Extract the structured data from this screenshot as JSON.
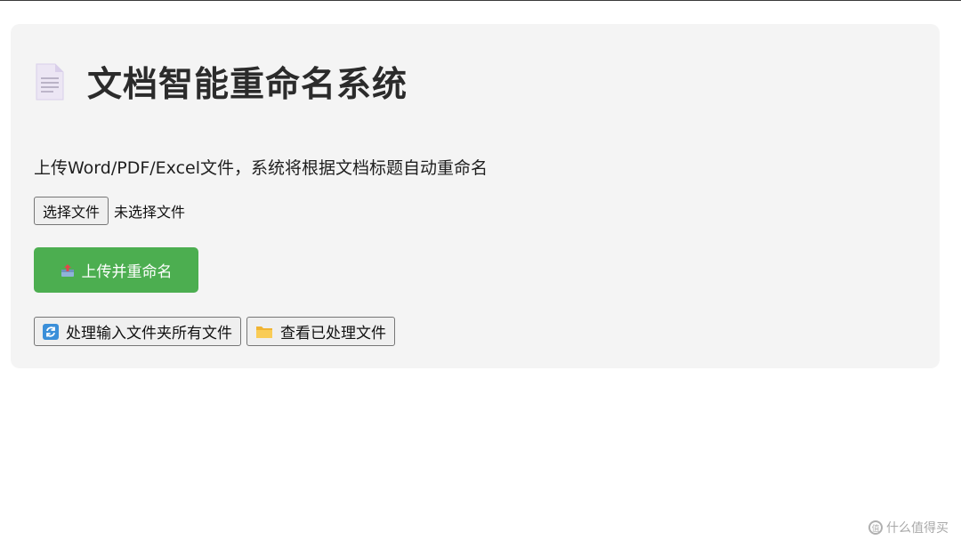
{
  "page": {
    "title": "文档智能重命名系统",
    "title_icon": "document-icon",
    "subtitle": "上传Word/PDF/Excel文件，系统将根据文档标题自动重命名"
  },
  "file_picker": {
    "button_label": "选择文件",
    "status": "未选择文件"
  },
  "upload_button": {
    "label": "上传并重命名",
    "icon": "inbox-upload-icon",
    "color": "#4cae50"
  },
  "actions": [
    {
      "label": "处理输入文件夹所有文件",
      "icon": "refresh-icon"
    },
    {
      "label": "查看已处理文件",
      "icon": "folder-icon"
    }
  ],
  "watermark": {
    "text": "什么值得买",
    "mark": "值"
  },
  "colors": {
    "card_background": "#f4f4f4",
    "title_text": "#2b2b2b"
  }
}
